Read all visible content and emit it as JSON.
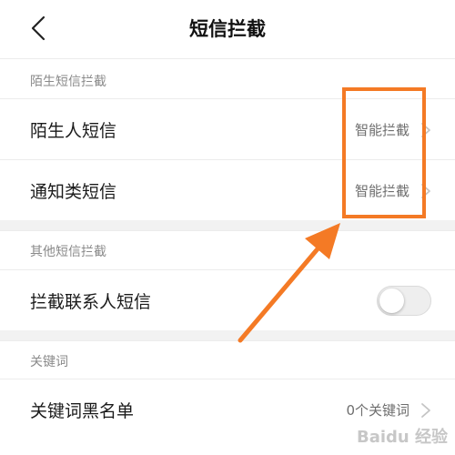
{
  "header": {
    "title": "短信拦截",
    "back_icon": "chevron-left-icon"
  },
  "sections": {
    "stranger": {
      "title": "陌生短信拦截"
    },
    "other": {
      "title": "其他短信拦截"
    },
    "keywords": {
      "title": "关键词"
    }
  },
  "rows": {
    "stranger_sms": {
      "label": "陌生人短信",
      "value": "智能拦截"
    },
    "notification_sms": {
      "label": "通知类短信",
      "value": "智能拦截"
    },
    "block_contacts": {
      "label": "拦截联系人短信",
      "toggle_on": false
    },
    "keyword_blacklist": {
      "label": "关键词黑名单",
      "value": "0个关键词"
    }
  },
  "annotation": {
    "color": "#f47a25"
  },
  "watermark": {
    "text": "Baidu 经验"
  },
  "colors": {
    "separator": "#f2f2f2",
    "secondary_text": "#8a8a8a",
    "chevron": "#c4c4c4"
  }
}
